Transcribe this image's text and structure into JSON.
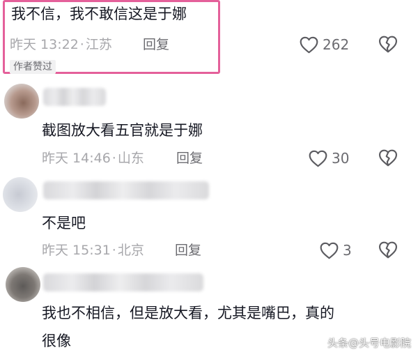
{
  "comments": [
    {
      "text": "我不信，我不敢信这是于娜",
      "time": "昨天 13:22",
      "location": "江苏",
      "reply_label": "回复",
      "likes": "262",
      "badge": "作者赞过",
      "highlight_color": "#e4609a"
    },
    {
      "text": "截图放大看五官就是于娜",
      "time": "昨天 14:46",
      "location": "山东",
      "reply_label": "回复",
      "likes": "30"
    },
    {
      "text": "不是吧",
      "time": "昨天 15:31",
      "location": "北京",
      "reply_label": "回复",
      "likes": "3"
    },
    {
      "text_line1": "我也不相信，但是放大看，尤其是嘴巴，真的",
      "text_line2": "很像"
    }
  ],
  "separator": "·",
  "icons": {
    "like": "heart-outline-icon",
    "dislike": "broken-heart-icon"
  },
  "watermark": "头条@头号电影院"
}
